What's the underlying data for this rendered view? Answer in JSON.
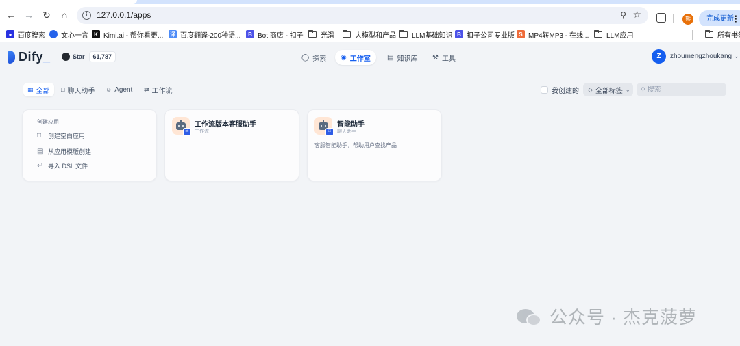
{
  "browser": {
    "url": "127.0.0.1/apps",
    "profile_initial": "熊",
    "update_label": "完成更新",
    "bookmarks": [
      {
        "label": "百度搜索",
        "icon": "baidu-icon",
        "color": "#2932e1"
      },
      {
        "label": "文心一言",
        "icon": "wenxin-icon",
        "color": "#2563eb"
      },
      {
        "label": "Kimi.ai - 帮你看更...",
        "icon": "kimi-icon",
        "color": "#111111"
      },
      {
        "label": "百度翻译-200种语...",
        "icon": "baidu-translate-icon",
        "color": "#4e8cf7"
      },
      {
        "label": "Bot 商店 - 扣子",
        "icon": "coze-icon",
        "color": "#4d53e8"
      },
      {
        "label": "光滑",
        "icon": "folder-icon"
      },
      {
        "label": "大模型和产品",
        "icon": "folder-icon"
      },
      {
        "label": "LLM基础知识",
        "icon": "folder-icon"
      },
      {
        "label": "扣子公司专业版",
        "icon": "coze-icon",
        "color": "#4d53e8"
      },
      {
        "label": "MP4转MP3 - 在线...",
        "icon": "convert-icon",
        "color": "#ef6c3a"
      },
      {
        "label": "LLM应用",
        "icon": "folder-icon"
      }
    ],
    "all_bookmarks": "所有书签"
  },
  "header": {
    "logo": "Dify",
    "github_star": "Star",
    "github_count": "61,787",
    "nav": [
      {
        "label": "探索",
        "icon": "explore-icon",
        "active": false
      },
      {
        "label": "工作室",
        "icon": "studio-icon",
        "active": true
      },
      {
        "label": "知识库",
        "icon": "knowledge-icon",
        "active": false
      },
      {
        "label": "工具",
        "icon": "tools-icon",
        "active": false
      }
    ],
    "user_initial": "Z",
    "user_name": "zhoumengzhoukang"
  },
  "filters": {
    "tabs": [
      {
        "label": "全部",
        "active": true
      },
      {
        "label": "聊天助手",
        "active": false
      },
      {
        "label": "Agent",
        "active": false
      },
      {
        "label": "工作流",
        "active": false
      }
    ],
    "mine_label": "我创建的",
    "tag_label": "全部标签",
    "search_placeholder": "搜索"
  },
  "create": {
    "title": "创建应用",
    "items": [
      "创建空白应用",
      "从应用模版创建",
      "导入 DSL 文件"
    ]
  },
  "apps": [
    {
      "name": "工作流版本客服助手",
      "type": "工作流",
      "description": ""
    },
    {
      "name": "智能助手",
      "type": "聊天助手",
      "description": "客服智能助手，帮助用户查找产品"
    }
  ],
  "watermark": "公众号 · 杰克菠萝"
}
